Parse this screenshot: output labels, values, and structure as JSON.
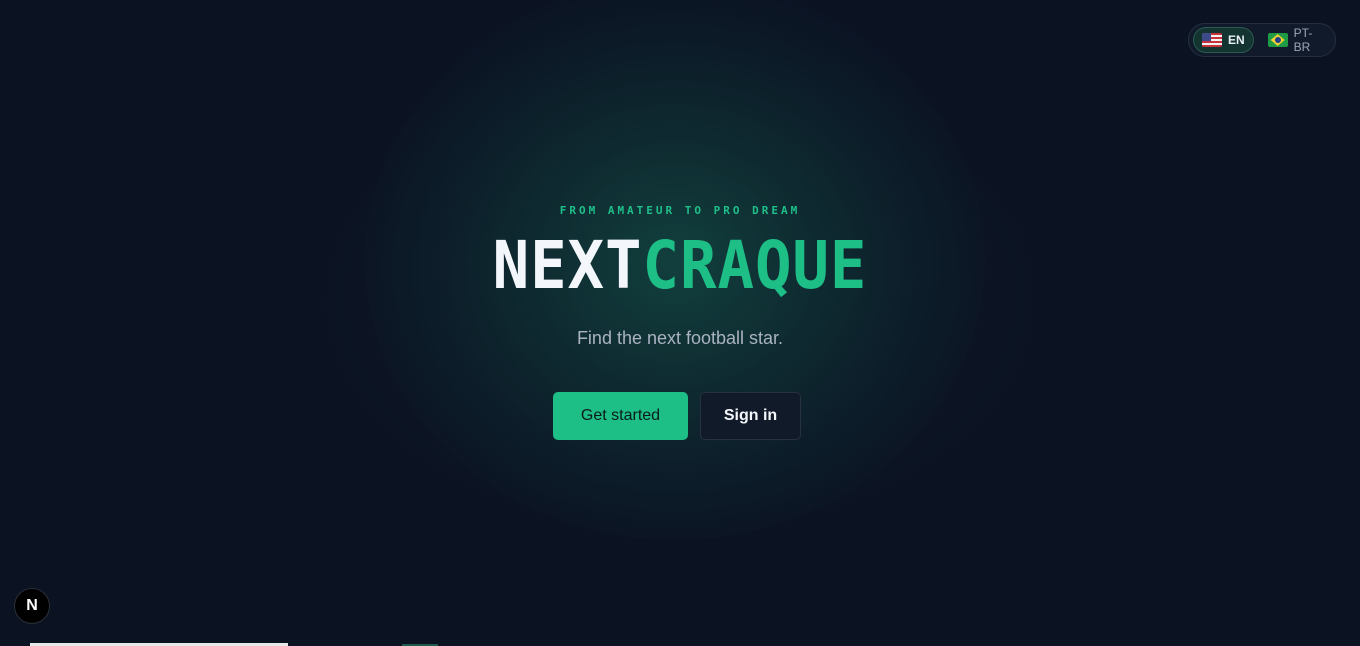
{
  "language_switcher": {
    "options": [
      {
        "label": "EN",
        "flag": "us-flag-icon",
        "active": true
      },
      {
        "label": "PT-BR",
        "flag": "brazil-flag-icon",
        "active": false
      }
    ]
  },
  "hero": {
    "eyebrow": "FROM AMATEUR TO PRO DREAM",
    "title_part1": "NEXT",
    "title_part2": "CRAQUE",
    "subtitle": "Find the next football star.",
    "primary_button": "Get started",
    "secondary_button": "Sign in"
  },
  "dev_indicator": {
    "label": "N"
  },
  "colors": {
    "background": "#0b1222",
    "accent": "#1dbf87",
    "text_primary": "#f3f6fa",
    "text_muted": "#a9b3c1"
  }
}
